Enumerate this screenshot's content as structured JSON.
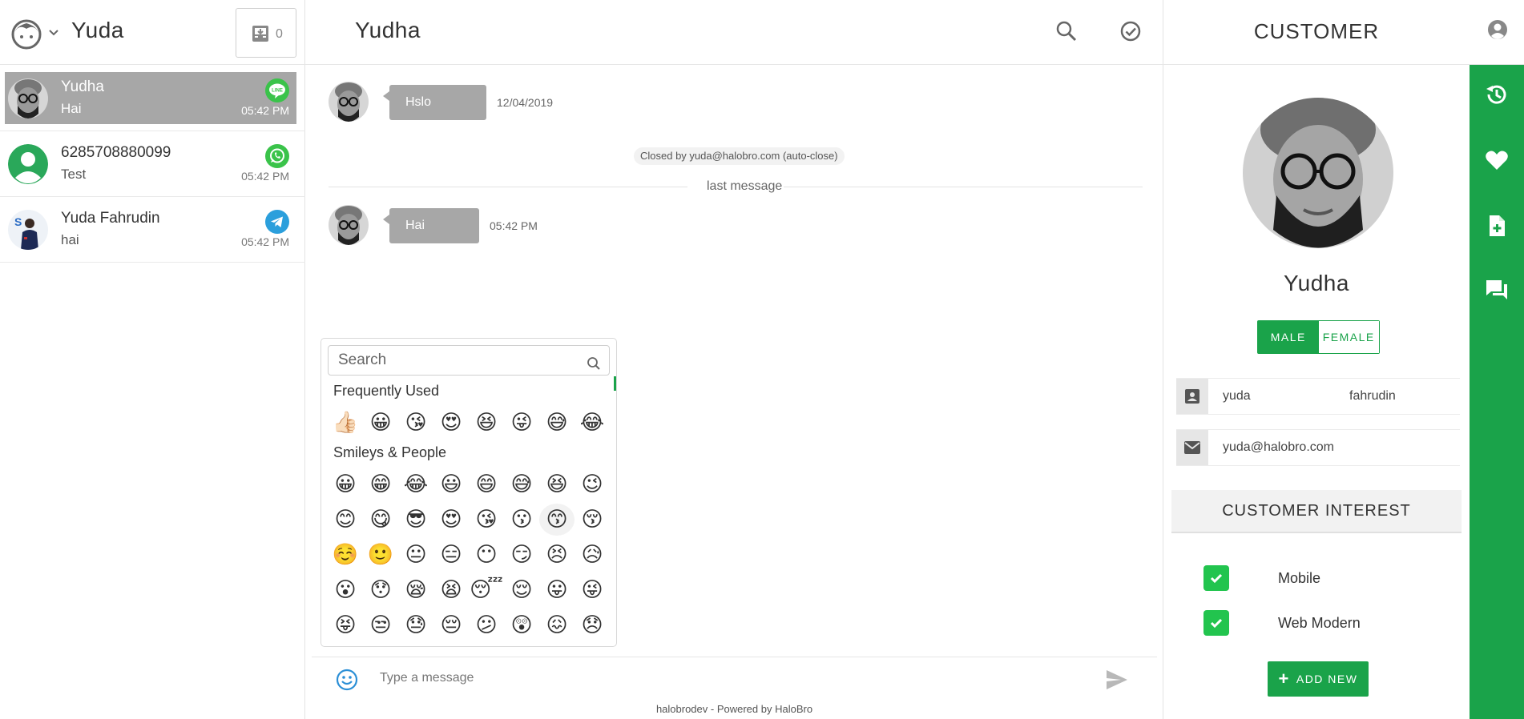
{
  "agent": {
    "name": "Yuda",
    "inbox_count": "0"
  },
  "conversations": [
    {
      "name": "Yudha",
      "last_message": "Hai",
      "time": "05:42 PM",
      "channel": "line",
      "active": true
    },
    {
      "name": "6285708880099",
      "last_message": "Test",
      "time": "05:42 PM",
      "channel": "whatsapp",
      "active": false
    },
    {
      "name": "Yuda Fahrudin",
      "last_message": "hai",
      "time": "05:42 PM",
      "channel": "telegram",
      "active": false
    }
  ],
  "chat": {
    "title": "Yudha",
    "messages": [
      {
        "text": "Hslo",
        "time": "12/04/2019"
      },
      {
        "text": "Hai",
        "time": "05:42 PM"
      }
    ],
    "system_note": "Closed by yuda@halobro.com (auto-close)",
    "divider_label": "last message",
    "input_placeholder": "Type a message",
    "footer": "halobrodev - Powered by HaloBro"
  },
  "emoji_picker": {
    "search_placeholder": "Search",
    "categories": [
      {
        "label": "Frequently Used",
        "rows": [
          [
            "👍🏻",
            "😀",
            "😘",
            "😍",
            "😆",
            "😜",
            "😅",
            "😂"
          ]
        ]
      },
      {
        "label": "Smileys & People",
        "rows": [
          [
            "😀",
            "😁",
            "😂",
            "😃",
            "😄",
            "😅",
            "😆",
            "😉"
          ],
          [
            "😊",
            "😋",
            "😎",
            "😍",
            "😘",
            "😗",
            "😙",
            "😚"
          ],
          [
            "☺️",
            "🙂",
            "😐",
            "😑",
            "😶",
            "😏",
            "😣",
            "😥"
          ],
          [
            "😮",
            "😯",
            "😪",
            "😫",
            "😴",
            "😌",
            "😛",
            "😜"
          ],
          [
            "😝",
            "😒",
            "😓",
            "😔",
            "😕",
            "😲",
            "😖",
            "😞"
          ]
        ]
      }
    ]
  },
  "customer": {
    "panel_title": "CUSTOMER",
    "name": "Yudha",
    "gender_options": [
      "MALE",
      "FEMALE"
    ],
    "gender_selected": "MALE",
    "first_name": "yuda",
    "last_name": "fahrudin",
    "email": "yuda@halobro.com",
    "interest_title": "CUSTOMER INTEREST",
    "interests": [
      {
        "label": "Mobile",
        "checked": true
      },
      {
        "label": "Web Modern",
        "checked": true
      }
    ],
    "add_new_label": "ADD NEW"
  },
  "colors": {
    "accent": "#1aa34a",
    "bubble": "#a7a7a7",
    "line": "#3ac34a",
    "whatsapp": "#3ac34a",
    "telegram": "#2b9fdc"
  }
}
